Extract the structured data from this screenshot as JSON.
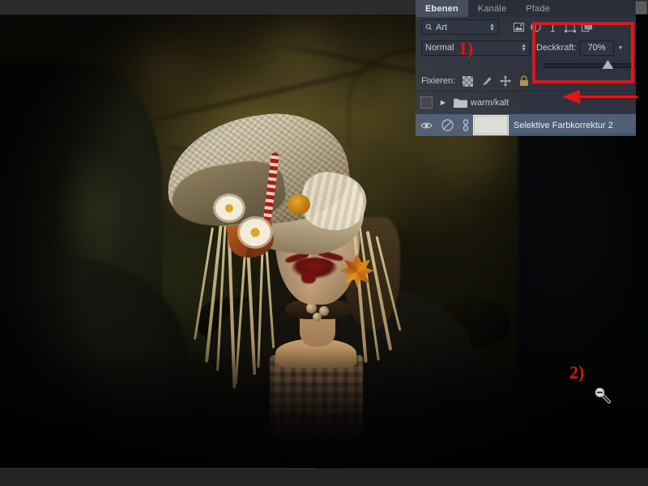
{
  "app": {
    "title": "Photoshop Ebenen-Bedienfeld"
  },
  "panel": {
    "tabs": [
      {
        "label": "Ebenen",
        "active": true
      },
      {
        "label": "Kanäle",
        "active": false
      },
      {
        "label": "Pfade",
        "active": false
      }
    ],
    "filter": {
      "kind_value": "Art",
      "kind_placeholder": "Art",
      "icons": [
        "image-filter-icon",
        "adjustment-filter-icon",
        "type-filter-icon",
        "shape-filter-icon",
        "smartobject-filter-icon"
      ]
    },
    "blend": {
      "mode_label": "Normal",
      "opacity_label": "Deckkraft:",
      "opacity_value": "70%",
      "opacity_percent": 70
    },
    "lock": {
      "label": "Fixieren:",
      "icons": [
        "lock-transparency-icon",
        "lock-image-icon",
        "lock-position-icon",
        "lock-all-icon"
      ]
    },
    "layers": [
      {
        "name": "warm/kalt",
        "type": "group",
        "visible": false,
        "selected": false,
        "expanded": false
      },
      {
        "name": "Selektive Farbkorrektur 2",
        "type": "adjustment",
        "visible": true,
        "selected": true,
        "linked": true,
        "has_mask": true
      }
    ]
  },
  "annotations": {
    "step1": "1)",
    "step2": "2)",
    "box_target": "Deckkraft-Bereich",
    "arrow_target": "warm/kalt",
    "cursor": "zoom-out-cursor"
  },
  "colors": {
    "annotation_red": "#e51515",
    "panel_bg": "#3a3f4e",
    "tab_active_bg": "#4a5060",
    "selected_layer_bg": "#5c708c",
    "chrome_bg": "#2b2b2b"
  },
  "canvas": {
    "description": "Foto einer Frau mit Jute-Hut im Wald"
  }
}
